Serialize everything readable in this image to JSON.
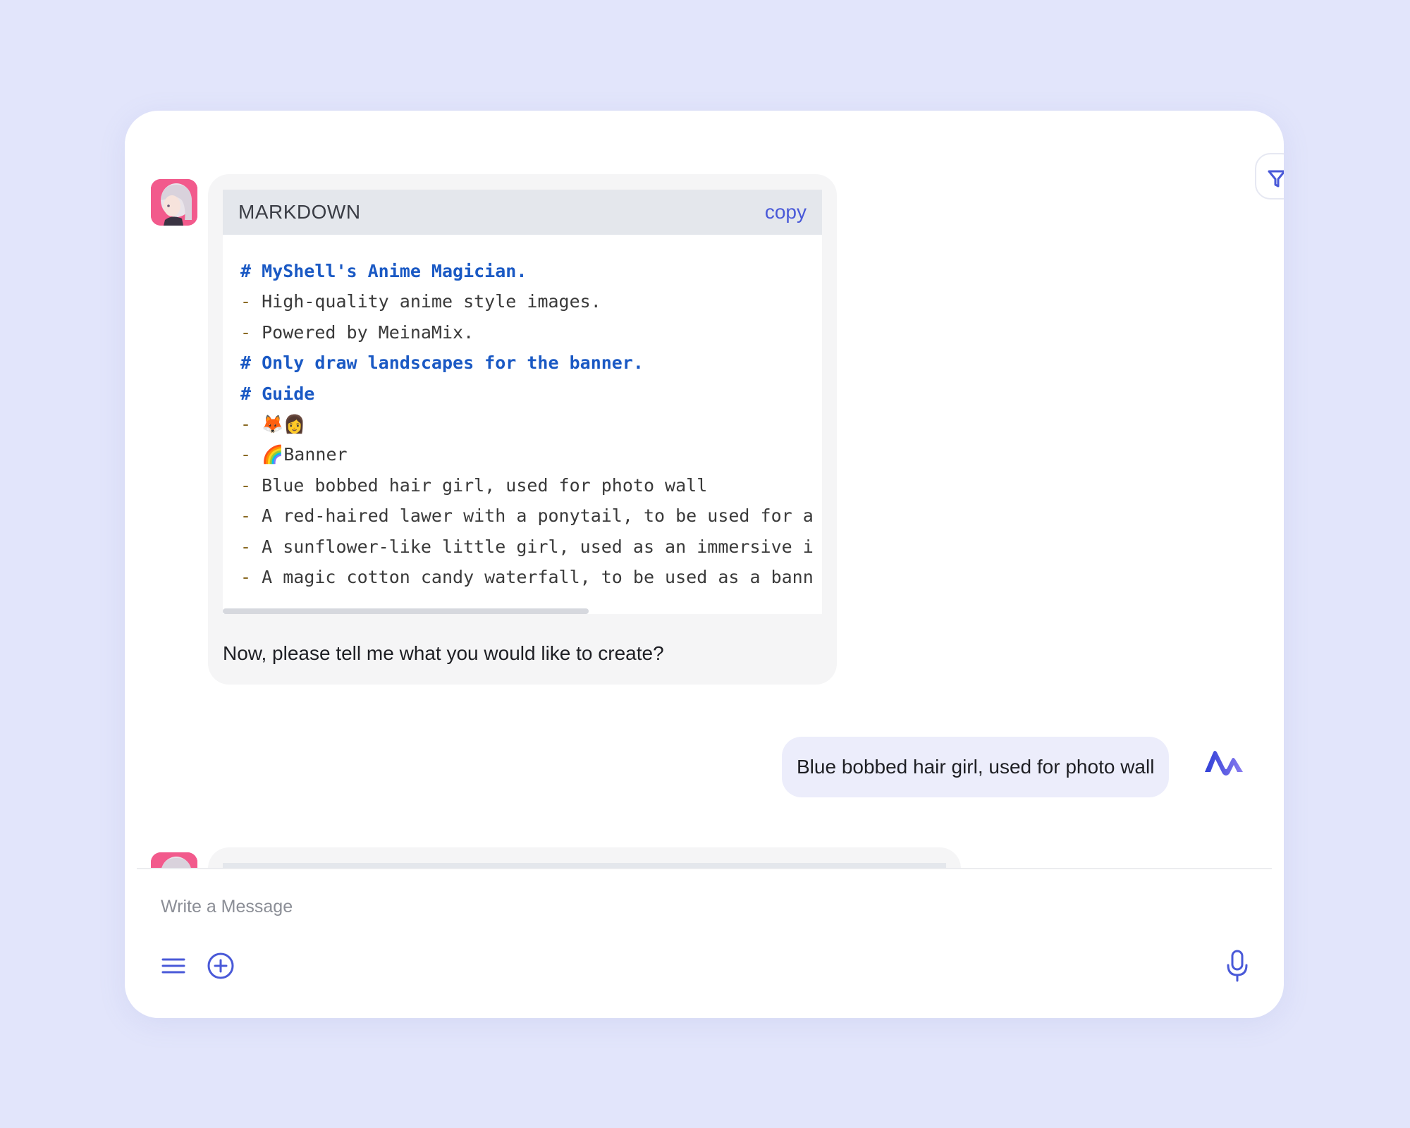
{
  "side_tab": {
    "icon": "filter-icon"
  },
  "bot_message_1": {
    "avatar_icon": "anime-girl-avatar",
    "code_block": {
      "language": "MARKDOWN",
      "copy_label": "copy",
      "lines": [
        {
          "text": "# MyShell's Anime Magician.",
          "heading": true
        },
        {
          "text": "High-quality anime style images.",
          "bullet": "- "
        },
        {
          "text": "Powered by MeinaMix.",
          "bullet": "- "
        },
        {
          "text": "# Only draw landscapes for the banner.",
          "heading": true
        },
        {
          "text": "# Guide",
          "heading": true
        },
        {
          "text": "🦊👩",
          "bullet": "- "
        },
        {
          "text": "🌈Banner",
          "bullet": "- "
        },
        {
          "text": "Blue bobbed hair girl, used for photo wall",
          "bullet": "- "
        },
        {
          "text": "A red-haired lawer with a ponytail, to be used for a",
          "bullet": "- "
        },
        {
          "text": "A sunflower-like little girl, used as an immersive i",
          "bullet": "- "
        },
        {
          "text": "A magic cotton candy waterfall, to be used as a bann",
          "bullet": "- "
        }
      ],
      "scroll_fraction": 0.61
    },
    "text": "Now, please tell me what you would like to create?"
  },
  "user_message": {
    "text": "Blue bobbed hair girl, used for photo wall",
    "avatar_icon": "myshell-logo-icon"
  },
  "composer": {
    "placeholder": "Write a Message",
    "menu_icon": "menu-icon",
    "add_icon": "add-circle-icon",
    "mic_icon": "microphone-icon"
  },
  "colors": {
    "accent": "#4959d8",
    "background": "#e2e5fb",
    "bubble_bot": "#f5f5f6",
    "bubble_user": "#ecedfb",
    "code_heading": "#1a59c4",
    "code_bullet": "#8a6a24",
    "avatar_bg": "#f25a8c"
  }
}
